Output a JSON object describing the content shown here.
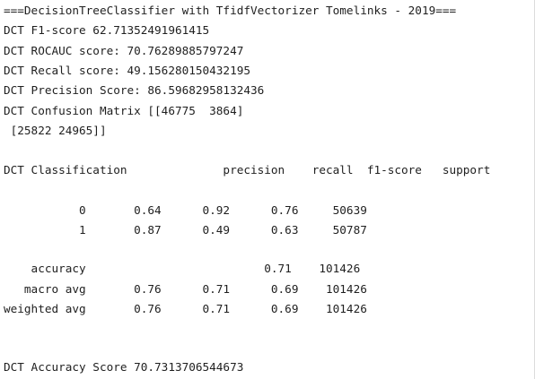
{
  "console": {
    "header": "===DecisionTreeClassifier with TfidfVectorizer Tomelinks - 2019===",
    "f1": "DCT F1-score 62.71352491961415",
    "rocauc": "DCT ROCAUC score: 70.76289885797247",
    "recall": "DCT Recall score: 49.156280150432195",
    "precision": "DCT Precision Score: 86.59682958132436",
    "confusion_1": "DCT Confusion Matrix [[46775  3864]",
    "confusion_2": " [25822 24965]]",
    "report_header": "DCT Classification              precision    recall  f1-score   support",
    "report_row_0": "           0       0.64      0.92      0.76     50639",
    "report_row_1": "           1       0.87      0.49      0.63     50787",
    "report_accuracy": "    accuracy                          0.71    101426",
    "report_macro": "   macro avg       0.76      0.71      0.69    101426",
    "report_weighted": "weighted avg       0.76      0.71      0.69    101426",
    "accuracy_score": "DCT Accuracy Score 70.7313706544673"
  }
}
